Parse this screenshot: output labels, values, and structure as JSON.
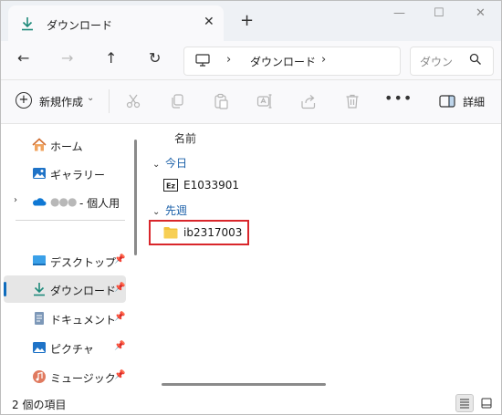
{
  "tab": {
    "title": "ダウンロード",
    "close_glyph": "✕",
    "new_tab_glyph": "+"
  },
  "window_controls": {
    "minimize": "—",
    "maximize": "☐",
    "close": "✕"
  },
  "nav": {
    "back": "←",
    "forward": "→",
    "up": "↑",
    "refresh": "↻"
  },
  "address": {
    "separator": "›",
    "crumb": "ダウンロード"
  },
  "search": {
    "placeholder": "ダウン"
  },
  "toolbar": {
    "new_label": "新規作成",
    "new_caret": "⌄",
    "more": "•••",
    "details_label": "詳細"
  },
  "sidebar": {
    "expander": "›",
    "pin_glyph": "📌",
    "items": [
      {
        "label": "ホーム",
        "icon": "home-icon"
      },
      {
        "label": "ギャラリー",
        "icon": "gallery-icon"
      },
      {
        "label": "- 個人用",
        "icon": "onedrive-icon",
        "blurred_prefix": "●●●"
      },
      {
        "label": "デスクトップ",
        "icon": "desktop-icon",
        "pinned": true
      },
      {
        "label": "ダウンロード",
        "icon": "download-icon",
        "pinned": true,
        "selected": true
      },
      {
        "label": "ドキュメント",
        "icon": "documents-icon",
        "pinned": true
      },
      {
        "label": "ピクチャ",
        "icon": "pictures-icon",
        "pinned": true
      },
      {
        "label": "ミュージック",
        "icon": "music-icon",
        "pinned": true
      }
    ]
  },
  "content": {
    "column_name": "名前",
    "groups": [
      {
        "title": "今日",
        "chevron": "⌄",
        "files": [
          {
            "name": "E1033901",
            "icon": "text-file-icon"
          }
        ]
      },
      {
        "title": "先週",
        "chevron": "⌄",
        "files": [
          {
            "name": "ib2317003",
            "icon": "folder-icon",
            "highlighted": true
          }
        ]
      }
    ]
  },
  "status": {
    "item_count": "2 個の項目"
  },
  "colors": {
    "accent": "#0f6cbd",
    "highlight_border": "#d9262b",
    "folder": "#f3c13a",
    "group_heading": "#1a5fa8"
  }
}
